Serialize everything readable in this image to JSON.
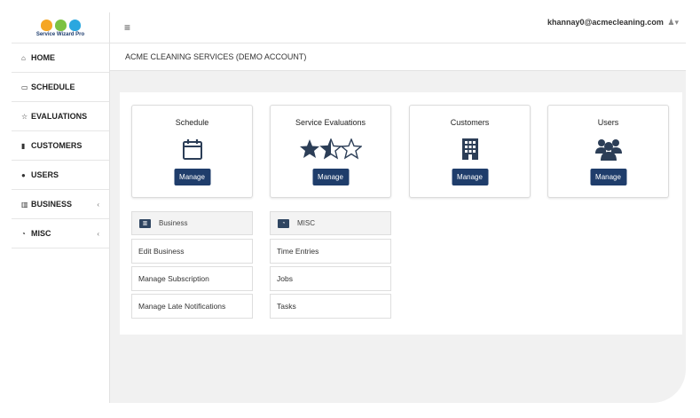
{
  "app": {
    "logo_text": "Service Wizard Pro",
    "user_email": "khannay0@acmecleaning.com",
    "breadcrumb": "ACME CLEANING SERVICES (DEMO ACCOUNT)"
  },
  "sidebar": {
    "items": [
      {
        "label": "HOME",
        "icon": "home-icon"
      },
      {
        "label": "SCHEDULE",
        "icon": "calendar-icon"
      },
      {
        "label": "EVALUATIONS",
        "icon": "star-icon"
      },
      {
        "label": "CUSTOMERS",
        "icon": "building-icon"
      },
      {
        "label": "USERS",
        "icon": "users-icon"
      },
      {
        "label": "BUSINESS",
        "icon": "bank-icon",
        "chevron": "‹"
      },
      {
        "label": "MISC",
        "icon": "clock-icon",
        "chevron": "‹"
      }
    ]
  },
  "cards": [
    {
      "title": "Schedule",
      "button": "Manage",
      "icon": "calendar-icon"
    },
    {
      "title": "Service Evaluations",
      "button": "Manage",
      "icon": "stars-rating-icon"
    },
    {
      "title": "Customers",
      "button": "Manage",
      "icon": "building-icon"
    },
    {
      "title": "Users",
      "button": "Manage",
      "icon": "users-icon"
    }
  ],
  "business": {
    "header": "Business",
    "items": [
      "Edit Business",
      "Manage Subscription",
      "Manage Late Notifications"
    ]
  },
  "misc": {
    "header": "MISC",
    "items": [
      "Time Entries",
      "Jobs",
      "Tasks"
    ]
  },
  "colors": {
    "button": "#1f3d6b",
    "icon": "#2c3e57",
    "brand_dark": "#1d3c6e"
  }
}
